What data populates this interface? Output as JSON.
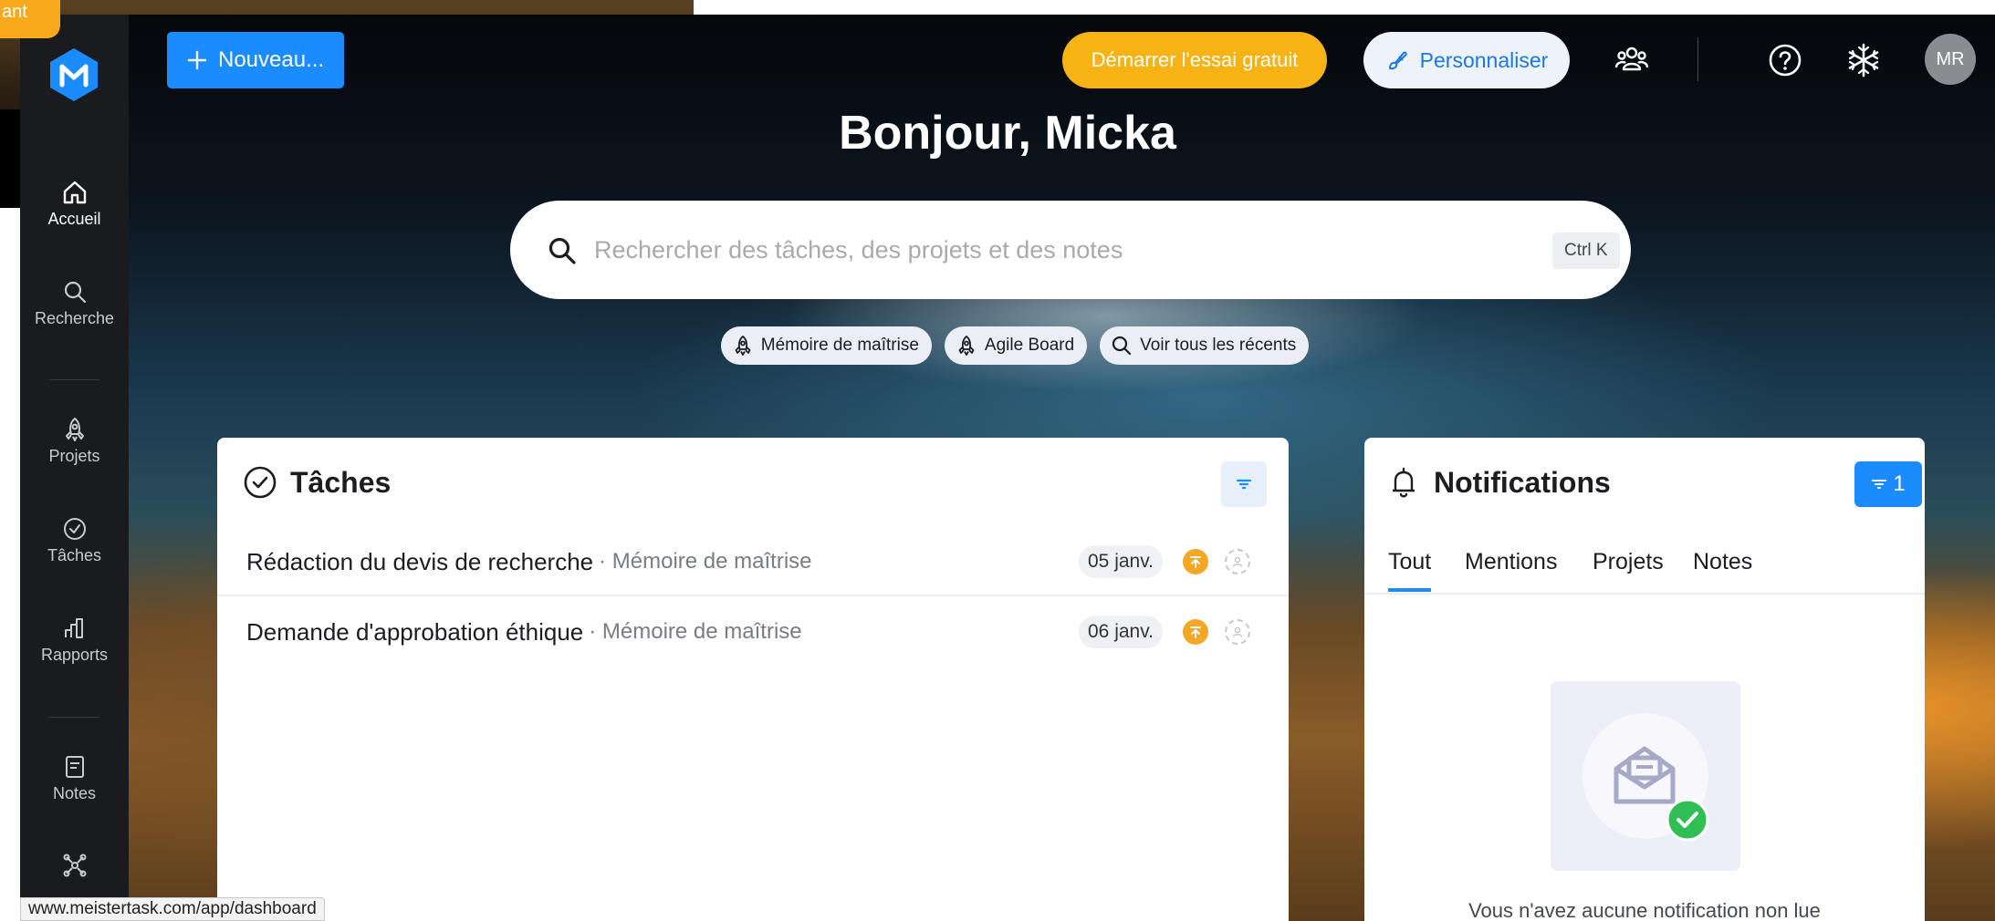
{
  "background_window": {
    "badge_text": "ant"
  },
  "header": {
    "new_button": "Nouveau...",
    "trial_button": "Démarrer l'essai gratuit",
    "customize_button": "Personnaliser",
    "avatar_initials": "MR"
  },
  "sidebar": {
    "items": [
      {
        "label": "Accueil",
        "icon": "home-icon",
        "active": true
      },
      {
        "label": "Recherche",
        "icon": "search-icon"
      },
      {
        "label": "Projets",
        "icon": "rocket-icon"
      },
      {
        "label": "Tâches",
        "icon": "check-circle-icon"
      },
      {
        "label": "Rapports",
        "icon": "bar-chart-icon"
      },
      {
        "label": "Notes",
        "icon": "note-icon"
      }
    ]
  },
  "greeting": "Bonjour, Micka",
  "search": {
    "placeholder": "Rechercher des tâches, des projets et des notes",
    "shortcut": "Ctrl K"
  },
  "chips": [
    {
      "label": "Mémoire de maîtrise",
      "icon": "rocket-icon"
    },
    {
      "label": "Agile Board",
      "icon": "rocket-icon"
    },
    {
      "label": "Voir tous les récents",
      "icon": "search-icon"
    }
  ],
  "tasks_panel": {
    "title": "Tâches",
    "rows": [
      {
        "title": "Rédaction du devis de recherche",
        "project": "· Mémoire de maîtrise",
        "date": "05 janv."
      },
      {
        "title": "Demande d'approbation éthique",
        "project": "· Mémoire de maîtrise",
        "date": "06 janv."
      }
    ]
  },
  "notifications_panel": {
    "title": "Notifications",
    "filter_count": "1",
    "tabs": [
      "Tout",
      "Mentions",
      "Projets",
      "Notes"
    ],
    "active_tab": "Tout",
    "empty_message": "Vous n'avez aucune notification non lue"
  },
  "status_url": "www.meistertask.com/app/dashboard",
  "colors": {
    "accent": "#1a8cff",
    "trial": "#f7b313",
    "priority": "#f5a623",
    "sidebar": "#1a1b1f"
  }
}
